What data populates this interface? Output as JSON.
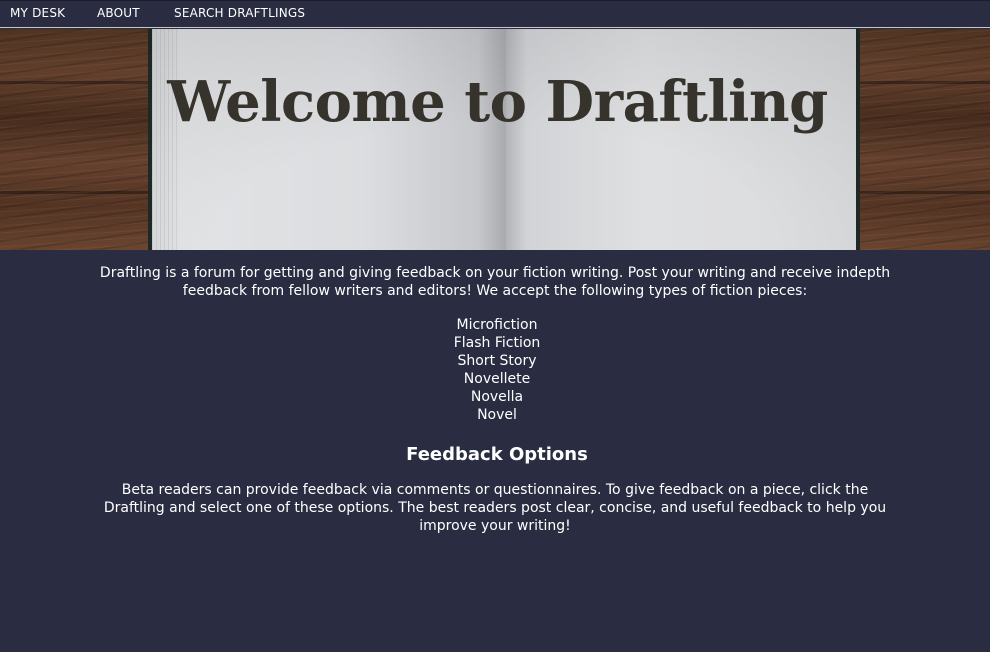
{
  "nav": {
    "items": [
      {
        "label": "MY DESK"
      },
      {
        "label": "ABOUT"
      },
      {
        "label": "SEARCH DRAFTLINGS"
      }
    ]
  },
  "hero": {
    "title": "Welcome to Draftling"
  },
  "intro": {
    "text": "Draftling is a forum for getting and giving feedback on your fiction writing. Post your writing and receive indepth feedback from fellow writers and editors! We accept the following types of fiction pieces:"
  },
  "fiction_types": [
    "Microfiction",
    "Flash Fiction",
    "Short Story",
    "Novellete",
    "Novella",
    "Novel"
  ],
  "feedback": {
    "heading": "Feedback Options",
    "text": "Beta readers can provide feedback via comments or questionnaires.  To give feedback on a piece, click the Draftling and select one of these options. The best readers post clear, concise, and useful feedback to help you improve your writing!"
  },
  "colors": {
    "background": "#2a2d42",
    "text": "#ffffff",
    "title": "#35332c"
  }
}
